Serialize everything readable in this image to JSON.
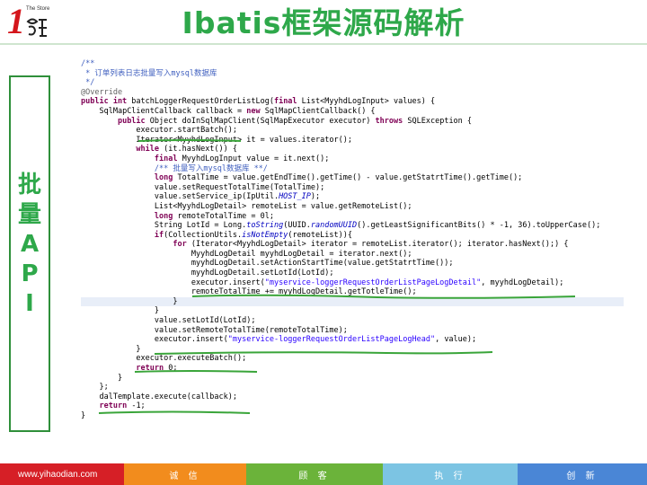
{
  "header": {
    "logo_digit": "1",
    "logo_store": "The Store",
    "title": "Ibatis框架源码解析"
  },
  "side_label": {
    "chars": [
      "批",
      "量",
      "A",
      "P",
      "I"
    ]
  },
  "code": {
    "lines": [
      {
        "indent": 0,
        "parts": [
          [
            "cm",
            "/**"
          ]
        ]
      },
      {
        "indent": 0,
        "parts": [
          [
            "cm",
            " * 订单列表日志批量写入mysql数据库"
          ]
        ]
      },
      {
        "indent": 0,
        "parts": [
          [
            "cm",
            " */"
          ]
        ]
      },
      {
        "indent": 0,
        "parts": [
          [
            "an",
            "@Override"
          ]
        ]
      },
      {
        "indent": 0,
        "parts": [
          [
            "kw",
            "public int"
          ],
          [
            "",
            " batchLoggerRequestOrderListLog("
          ],
          [
            "kw",
            "final"
          ],
          [
            "",
            " List<MyyhdLogInput> values) {"
          ]
        ]
      },
      {
        "indent": 4,
        "parts": [
          [
            "",
            "SqlMapClientCallback callback = "
          ],
          [
            "kw",
            "new"
          ],
          [
            "",
            " SqlMapClientCallback() {"
          ]
        ]
      },
      {
        "indent": 8,
        "parts": [
          [
            "kw",
            "public"
          ],
          [
            "",
            " Object doInSqlMapClient(SqlMapExecutor executor) "
          ],
          [
            "kw",
            "throws"
          ],
          [
            "",
            " SQLException {"
          ]
        ]
      },
      {
        "indent": 12,
        "parts": [
          [
            "",
            "executor.startBatch();"
          ]
        ]
      },
      {
        "indent": 12,
        "parts": [
          [
            "",
            "Iterator<MyyhdLogInput> it = values.iterator();"
          ]
        ]
      },
      {
        "indent": 12,
        "parts": [
          [
            "kw",
            "while"
          ],
          [
            "",
            " (it.hasNext()) {"
          ]
        ]
      },
      {
        "indent": 16,
        "parts": [
          [
            "kw",
            "final"
          ],
          [
            "",
            " MyyhdLogInput value = it.next();"
          ]
        ]
      },
      {
        "indent": 16,
        "parts": [
          [
            "cm",
            "/** 批量写入mysql数据库 **/"
          ]
        ]
      },
      {
        "indent": 16,
        "parts": [
          [
            "kw",
            "long"
          ],
          [
            "",
            " TotalTime = value.getEndTime().getTime() - value.getStatrtTime().getTime();"
          ]
        ]
      },
      {
        "indent": 16,
        "parts": [
          [
            "",
            "value.setRequestTotalTime(TotalTime);"
          ]
        ]
      },
      {
        "indent": 16,
        "parts": [
          [
            "",
            "value.setService_ip(IpUtil."
          ],
          [
            "it",
            "HOST_IP"
          ],
          [
            "",
            ");"
          ]
        ]
      },
      {
        "indent": 16,
        "parts": [
          [
            "",
            "List<MyyhdLogDetail> remoteList = value.getRemoteList();"
          ]
        ]
      },
      {
        "indent": 16,
        "parts": [
          [
            "kw",
            "long"
          ],
          [
            "",
            " remoteTotalTime = 0l;"
          ]
        ]
      },
      {
        "indent": 16,
        "parts": [
          [
            "",
            "String LotId = Long."
          ],
          [
            "it",
            "toString"
          ],
          [
            "",
            "(UUID."
          ],
          [
            "it",
            "randomUUID"
          ],
          [
            "",
            "().getLeastSignificantBits() * -1, 36).toUpperCase();"
          ]
        ]
      },
      {
        "indent": 16,
        "parts": [
          [
            "kw",
            "if"
          ],
          [
            "",
            "(CollectionUtils."
          ],
          [
            "it",
            "isNotEmpty"
          ],
          [
            "",
            "(remoteList)){"
          ]
        ]
      },
      {
        "indent": 20,
        "parts": [
          [
            "kw",
            "for"
          ],
          [
            "",
            " (Iterator<MyyhdLogDetail> iterator = remoteList.iterator(); iterator.hasNext();) {"
          ]
        ]
      },
      {
        "indent": 24,
        "parts": [
          [
            "",
            "MyyhdLogDetail myyhdLogDetail = iterator.next();"
          ]
        ]
      },
      {
        "indent": 24,
        "parts": [
          [
            "",
            "myyhdLogDetail.setActionStartTime(value.getStatrtTime());"
          ]
        ]
      },
      {
        "indent": 24,
        "parts": [
          [
            "",
            "myyhdLogDetail.setLotId(LotId);"
          ]
        ]
      },
      {
        "indent": 24,
        "parts": [
          [
            "",
            "executor.insert("
          ],
          [
            "st",
            "\"myservice-loggerRequestOrderListPageLogDetail\""
          ],
          [
            "",
            ", myyhdLogDetail);"
          ]
        ]
      },
      {
        "indent": 24,
        "parts": [
          [
            "",
            "remoteTotalTime += myyhdLogDetail.getTotleTime();"
          ]
        ]
      },
      {
        "indent": 20,
        "parts": [
          [
            "",
            "}"
          ]
        ],
        "highlight": true
      },
      {
        "indent": 16,
        "parts": [
          [
            "",
            "}"
          ]
        ]
      },
      {
        "indent": 16,
        "parts": [
          [
            "",
            "value.setLotId(LotId);"
          ]
        ]
      },
      {
        "indent": 16,
        "parts": [
          [
            "",
            "value.setRemoteTotalTime(remoteTotalTime);"
          ]
        ]
      },
      {
        "indent": 16,
        "parts": [
          [
            "",
            "executor.insert("
          ],
          [
            "st",
            "\"myservice-loggerRequestOrderListPageLogHead\""
          ],
          [
            "",
            ", value);"
          ]
        ]
      },
      {
        "indent": 12,
        "parts": [
          [
            "",
            "}"
          ]
        ]
      },
      {
        "indent": 12,
        "parts": [
          [
            "",
            "executor.executeBatch();"
          ]
        ]
      },
      {
        "indent": 12,
        "parts": [
          [
            "kw",
            "return"
          ],
          [
            "",
            " 0;"
          ]
        ]
      },
      {
        "indent": 8,
        "parts": [
          [
            "",
            "}"
          ]
        ]
      },
      {
        "indent": 4,
        "parts": [
          [
            "",
            "};"
          ]
        ]
      },
      {
        "indent": 4,
        "parts": [
          [
            "",
            "dalTemplate.execute(callback);"
          ]
        ]
      },
      {
        "indent": 4,
        "parts": [
          [
            "kw",
            "return"
          ],
          [
            "",
            " -1;"
          ]
        ]
      },
      {
        "indent": 0,
        "parts": [
          [
            "",
            "}"
          ]
        ]
      }
    ]
  },
  "footer": {
    "url": "www.yihaodian.com",
    "values": [
      "诚 信",
      "顾 客",
      "执 行",
      "创 新"
    ]
  },
  "colors": {
    "title": "#2ea84a",
    "mark": "#3aa53a",
    "footer_red": "#d61f26",
    "footer_orange": "#f28c1d",
    "footer_green": "#6bb33a",
    "footer_lightblue": "#7cc4e3",
    "footer_blue": "#4a86d6"
  }
}
